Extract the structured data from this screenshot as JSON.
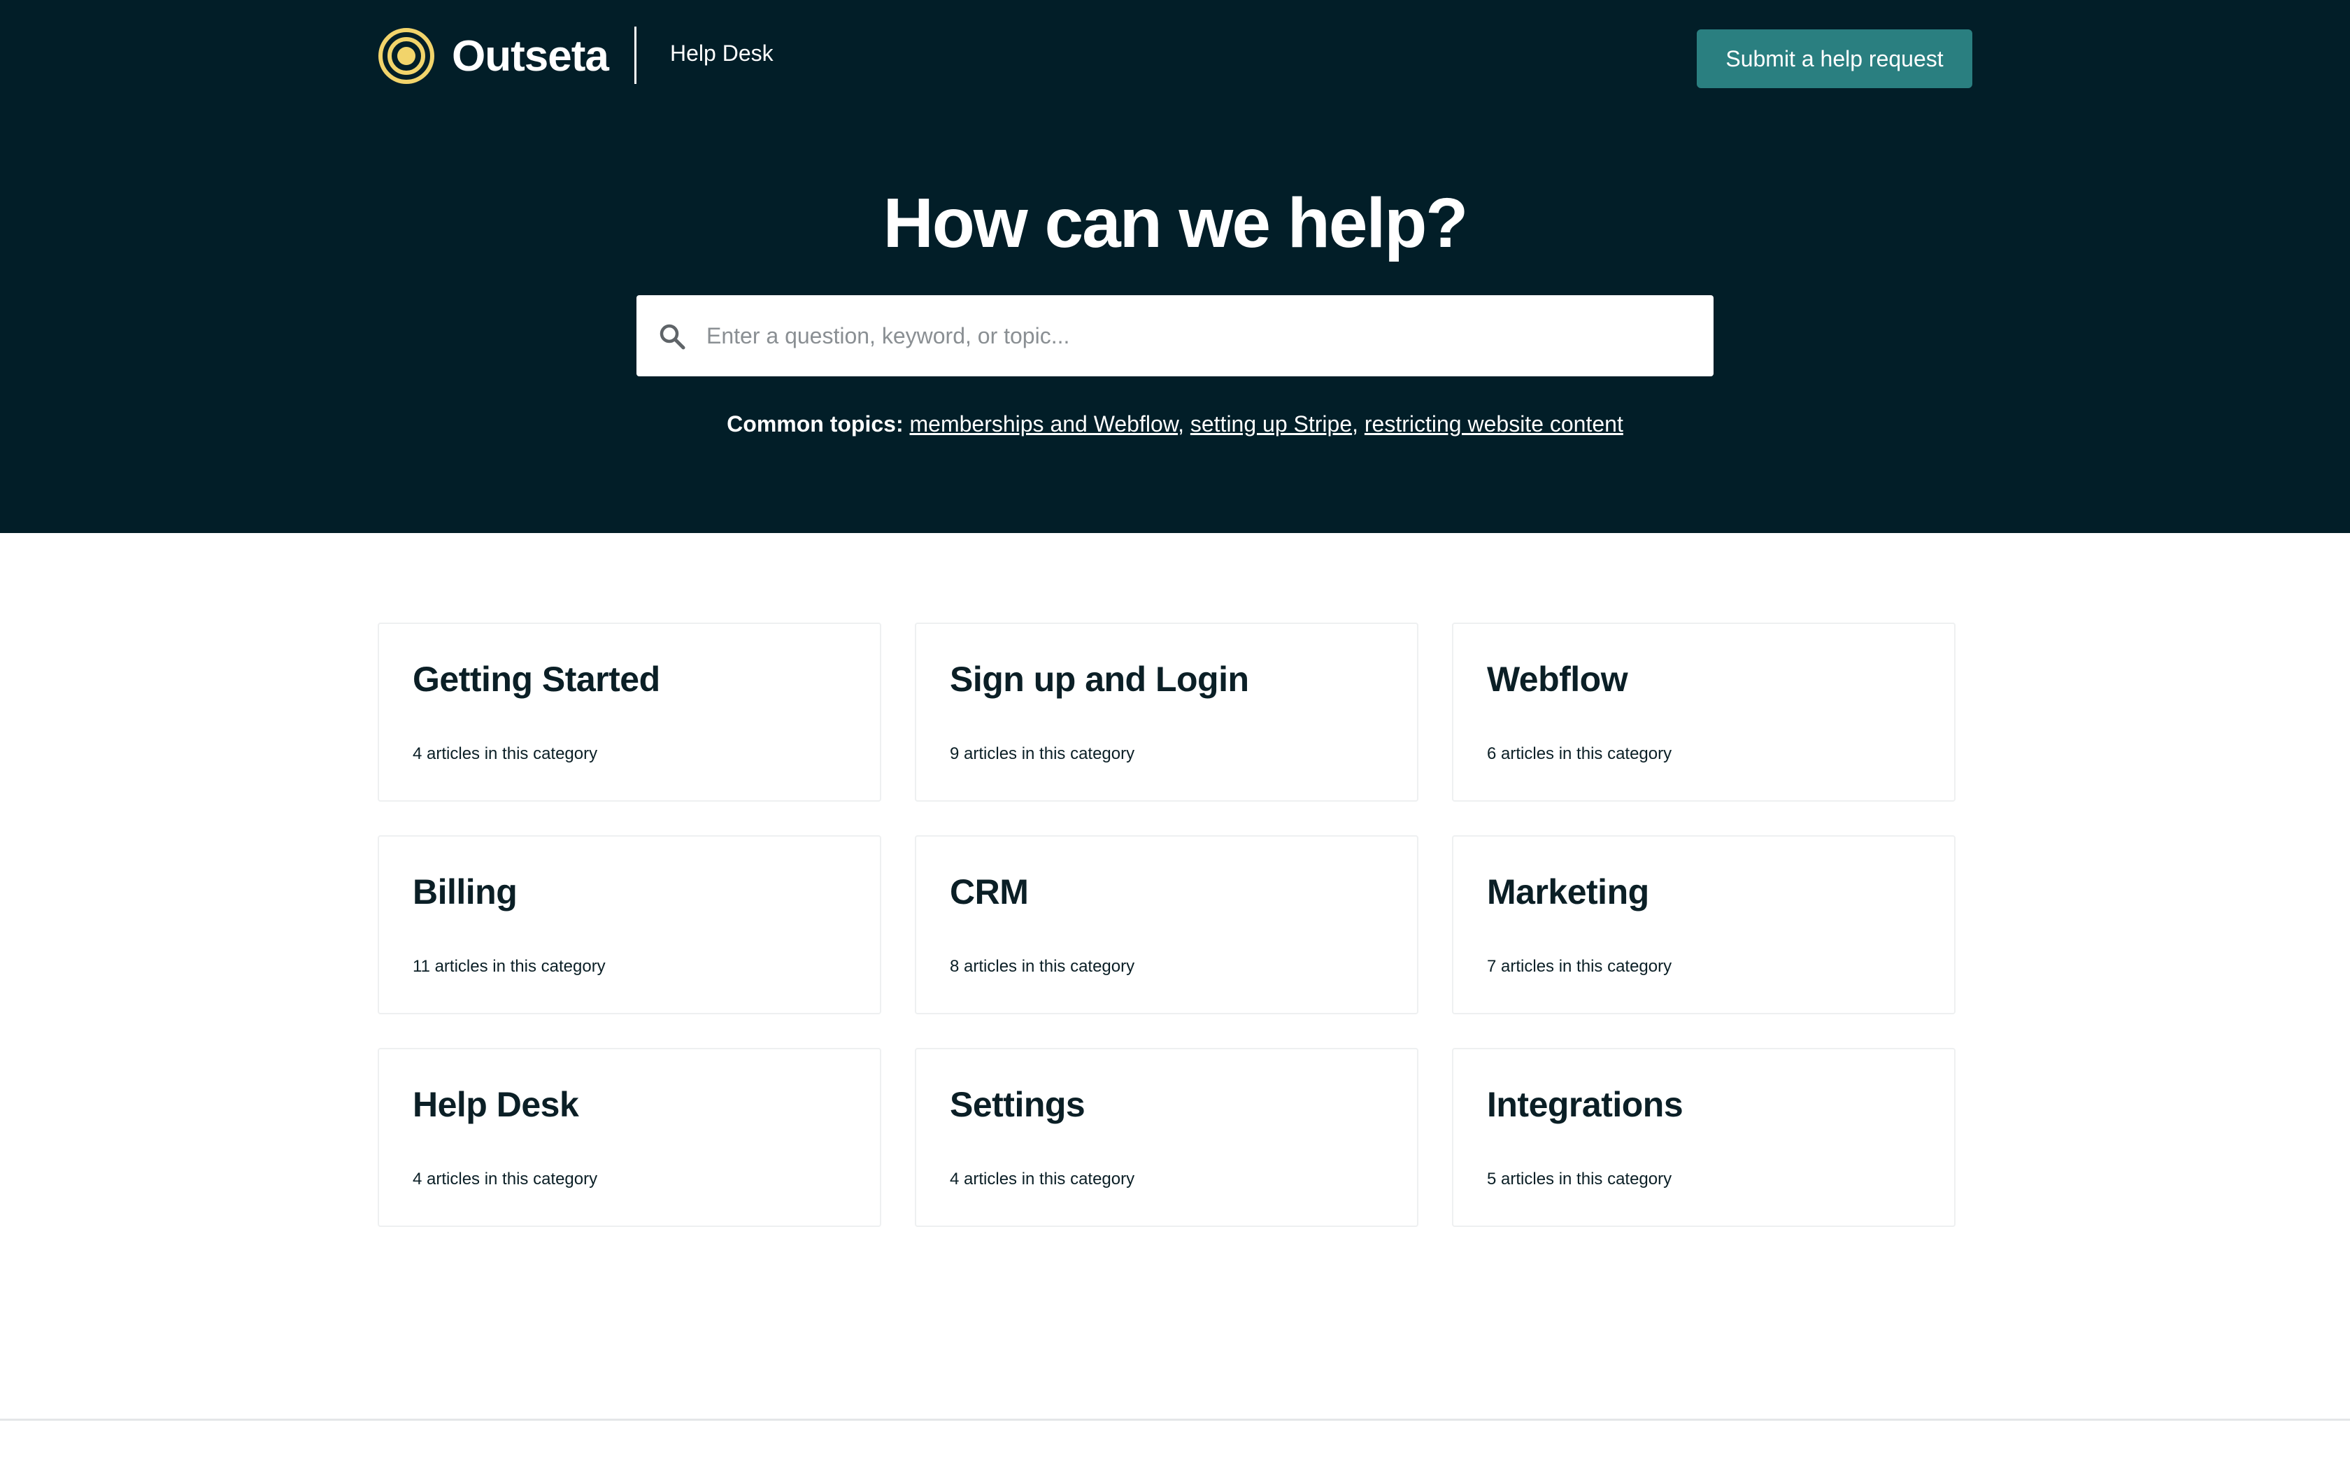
{
  "header": {
    "brand": "Outseta",
    "section_label": "Help Desk",
    "submit_button": "Submit a help request",
    "colors": {
      "background": "#021e28",
      "accent": "#2a7f80",
      "logo_mark": "#f2d46b"
    }
  },
  "hero": {
    "title": "How can we help?",
    "search": {
      "placeholder": "Enter a question, keyword, or topic...",
      "value": ""
    },
    "common_topics": {
      "label": "Common topics:",
      "links": [
        "memberships and Webflow",
        "setting up Stripe",
        "restricting website content"
      ]
    }
  },
  "categories": [
    {
      "title": "Getting Started",
      "count": "4 articles in this category"
    },
    {
      "title": "Sign up and Login",
      "count": "9 articles in this category"
    },
    {
      "title": "Webflow",
      "count": "6 articles in this category"
    },
    {
      "title": "Billing",
      "count": "11 articles in this category"
    },
    {
      "title": "CRM",
      "count": "8 articles in this category"
    },
    {
      "title": "Marketing",
      "count": "7 articles in this category"
    },
    {
      "title": "Help Desk",
      "count": "4 articles in this category"
    },
    {
      "title": "Settings",
      "count": "4 articles in this category"
    },
    {
      "title": "Integrations",
      "count": "5 articles in this category"
    }
  ]
}
